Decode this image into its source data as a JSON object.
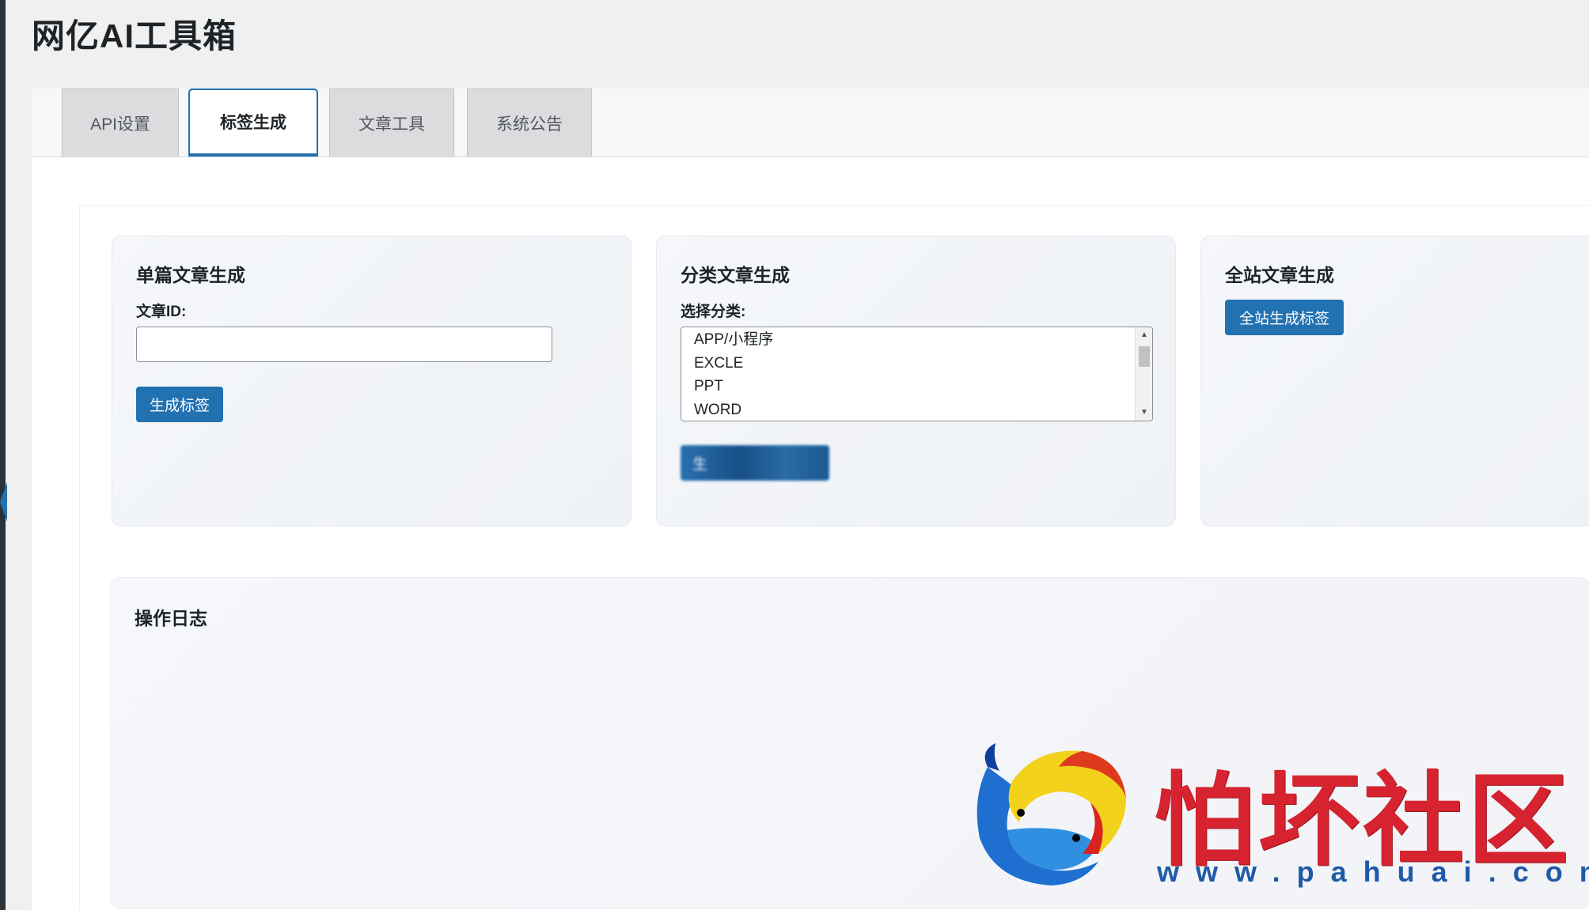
{
  "app": {
    "title": "网亿AI工具箱"
  },
  "tabs": [
    {
      "label": "API设置"
    },
    {
      "label": "标签生成"
    },
    {
      "label": "文章工具"
    },
    {
      "label": "系统公告"
    }
  ],
  "active_tab": "标签生成",
  "single_card": {
    "title": "单篇文章生成",
    "field_label": "文章ID:",
    "input_value": "",
    "button_label": "生成标签"
  },
  "category_card": {
    "title": "分类文章生成",
    "field_label": "选择分类:",
    "options": [
      "APP/小程序",
      "EXCLE",
      "PPT",
      "WORD"
    ],
    "button_label_visible": "生"
  },
  "site_card": {
    "title": "全站文章生成",
    "button_label": "全站生成标签"
  },
  "log_card": {
    "title": "操作日志"
  },
  "watermark": {
    "text": "怕坏社区",
    "url": "www.pahuai.com"
  },
  "colors": {
    "primary": "#2271b1",
    "watermark_red": "#d6232f",
    "watermark_blue": "#1f5aa8"
  }
}
